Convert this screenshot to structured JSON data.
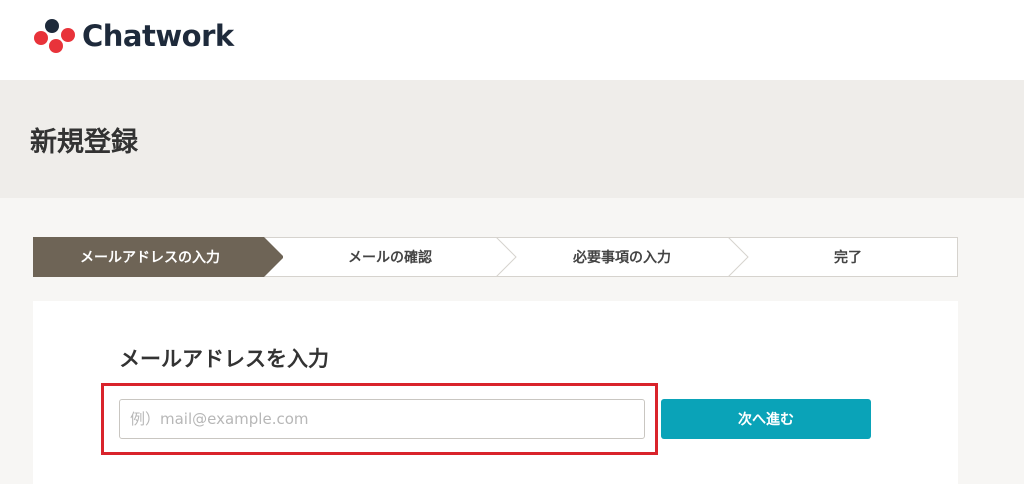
{
  "brand": {
    "name": "Chatwork",
    "colors": {
      "red": "#e8333a",
      "dark": "#1e2a3b",
      "accent": "#0aa3b8",
      "step_active": "#6e6456"
    }
  },
  "page": {
    "title": "新規登録"
  },
  "steps": [
    {
      "label": "メールアドレスの入力",
      "active": true
    },
    {
      "label": "メールの確認",
      "active": false
    },
    {
      "label": "必要事項の入力",
      "active": false
    },
    {
      "label": "完了",
      "active": false
    }
  ],
  "form": {
    "title": "メールアドレスを入力",
    "email_value": "",
    "email_placeholder": "例）mail@example.com",
    "submit_label": "次へ進む"
  }
}
